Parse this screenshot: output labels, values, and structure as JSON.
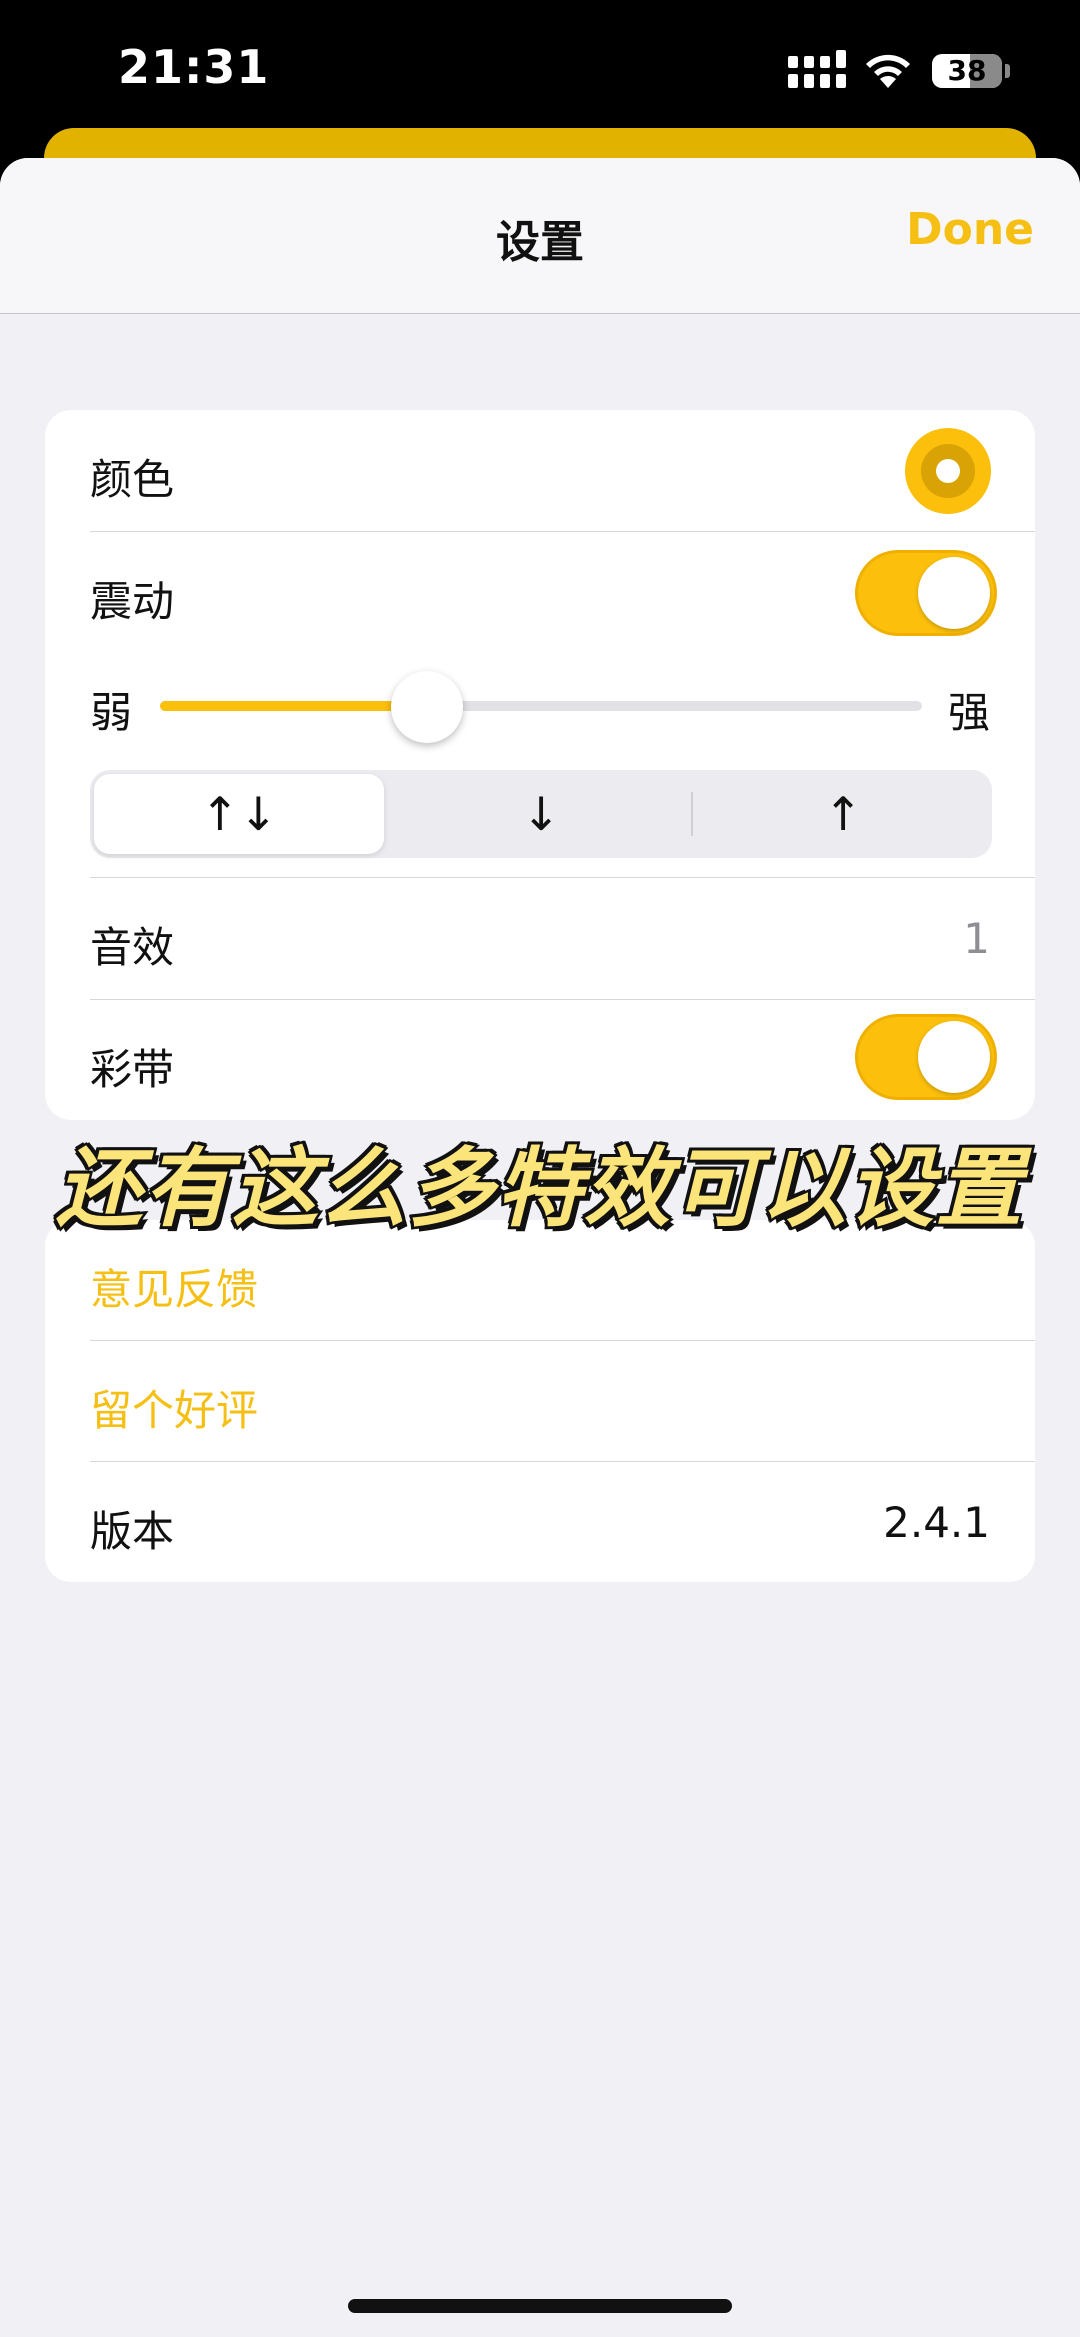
{
  "status_bar": {
    "time": "21:31",
    "battery": "38"
  },
  "nav": {
    "title": "设置",
    "done_label": "Done"
  },
  "settings": {
    "color_label": "颜色",
    "vibration_label": "震动",
    "vibration_on": true,
    "intensity": {
      "weak_label": "弱",
      "strong_label": "强",
      "level": 0.35
    },
    "direction_options": [
      "↑↓",
      "↓",
      "↑"
    ],
    "direction_selected": 0,
    "sound_label": "音效",
    "sound_value": "1",
    "confetti_label": "彩带",
    "confetti_on": true
  },
  "overlay_caption": "还有这么多特效可以设置",
  "about": {
    "feedback_label": "意见反馈",
    "review_label": "留个好评",
    "version_label": "版本",
    "version_value": "2.4.1"
  },
  "colors": {
    "accent": "#fbbf0c",
    "background": "#f0f0f5"
  }
}
